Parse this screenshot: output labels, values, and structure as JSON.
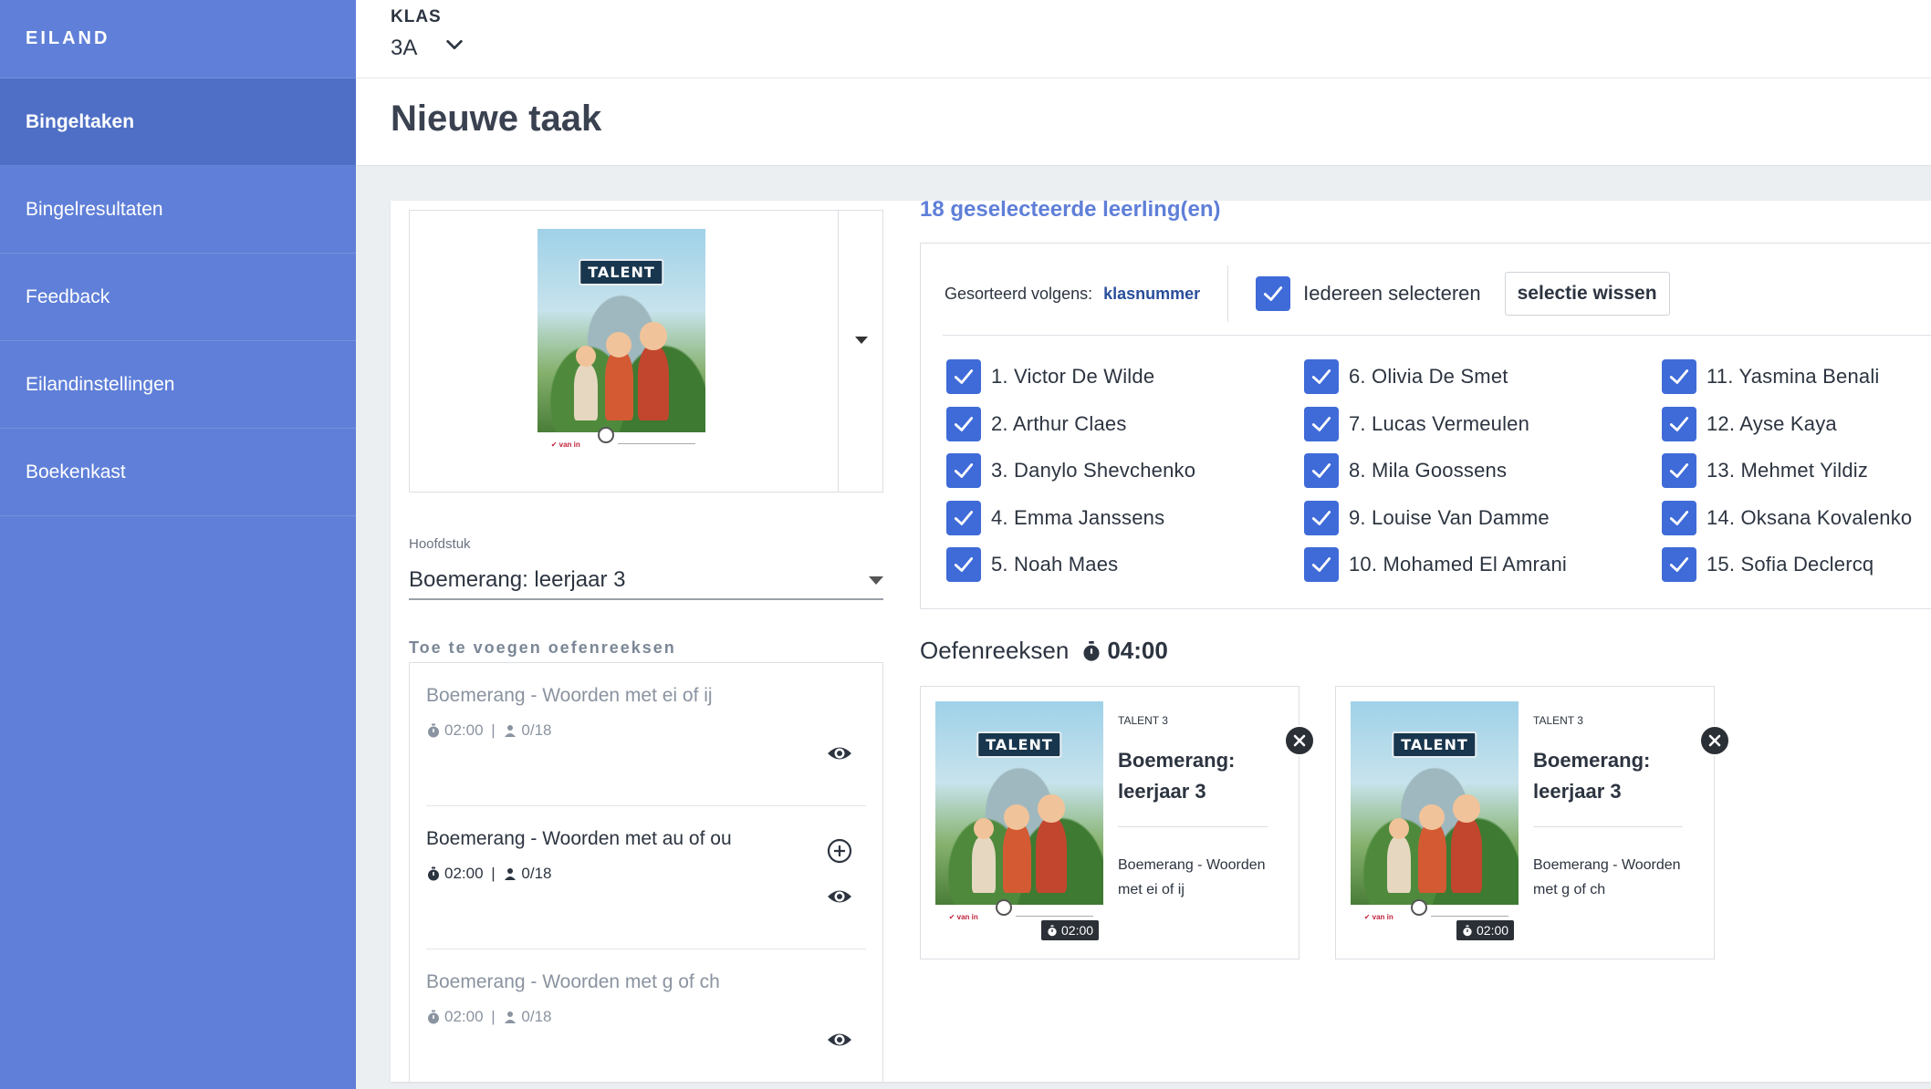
{
  "sidebar": {
    "brand": "EILAND",
    "items": [
      {
        "label": "Bingeltaken",
        "active": true
      },
      {
        "label": "Bingelresultaten"
      },
      {
        "label": "Feedback"
      },
      {
        "label": "Eilandinstellingen"
      },
      {
        "label": "Boekenkast"
      }
    ]
  },
  "header": {
    "klas_label": "KLAS",
    "klas_value": "3A",
    "title": "Nieuwe taak"
  },
  "book": {
    "cover_logo": "TALENT"
  },
  "hoofdstuk": {
    "label": "Hoofdstuk",
    "value": "Boemerang: leerjaar 3"
  },
  "oefenreeksen_toevoegen": {
    "label": "Toe te voegen oefenreeksen",
    "items": [
      {
        "title": "Boemerang - Woorden met ei of ij",
        "duration": "02:00",
        "count": "0/18",
        "added": true
      },
      {
        "title": "Boemerang - Woorden met au of ou",
        "duration": "02:00",
        "count": "0/18",
        "added": false
      },
      {
        "title": "Boemerang - Woorden met g of ch",
        "duration": "02:00",
        "count": "0/18",
        "added": true
      }
    ]
  },
  "students": {
    "selected_count": "18 geselecteerde leerling(en)",
    "sort_label": "Gesorteerd volgens:",
    "sort_value": "klasnummer",
    "select_all_label": "Iedereen selecteren",
    "clear_label": "selectie wissen",
    "list": [
      "1. Victor De Wilde",
      "2. Arthur Claes",
      "3. Danylo Shevchenko",
      "4. Emma Janssens",
      "5. Noah Maes",
      "6. Olivia De Smet",
      "7. Lucas Vermeulen",
      "8. Mila Goossens",
      "9. Louise Van Damme",
      "10. Mohamed El Amrani",
      "11. Yasmina Benali",
      "12. Ayse Kaya",
      "13. Mehmet Yildiz",
      "14. Oksana Kovalenko",
      "15. Sofia Declercq"
    ]
  },
  "oefenreeksen": {
    "title": "Oefenreeksen",
    "total_time": "04:00",
    "cards": [
      {
        "series": "TALENT 3",
        "title": "Boemerang: leerjaar 3",
        "subtitle": "Boemerang - Woorden met ei of ij",
        "duration": "02:00"
      },
      {
        "series": "TALENT 3",
        "title": "Boemerang: leerjaar 3",
        "subtitle": "Boemerang - Woorden met g of ch",
        "duration": "02:00"
      }
    ]
  },
  "colors": {
    "sidebar": "#5f7fd8",
    "sidebar_active": "#4f6fc6",
    "checkbox": "#3f6bd8",
    "accent_text": "#5f7fd8"
  }
}
